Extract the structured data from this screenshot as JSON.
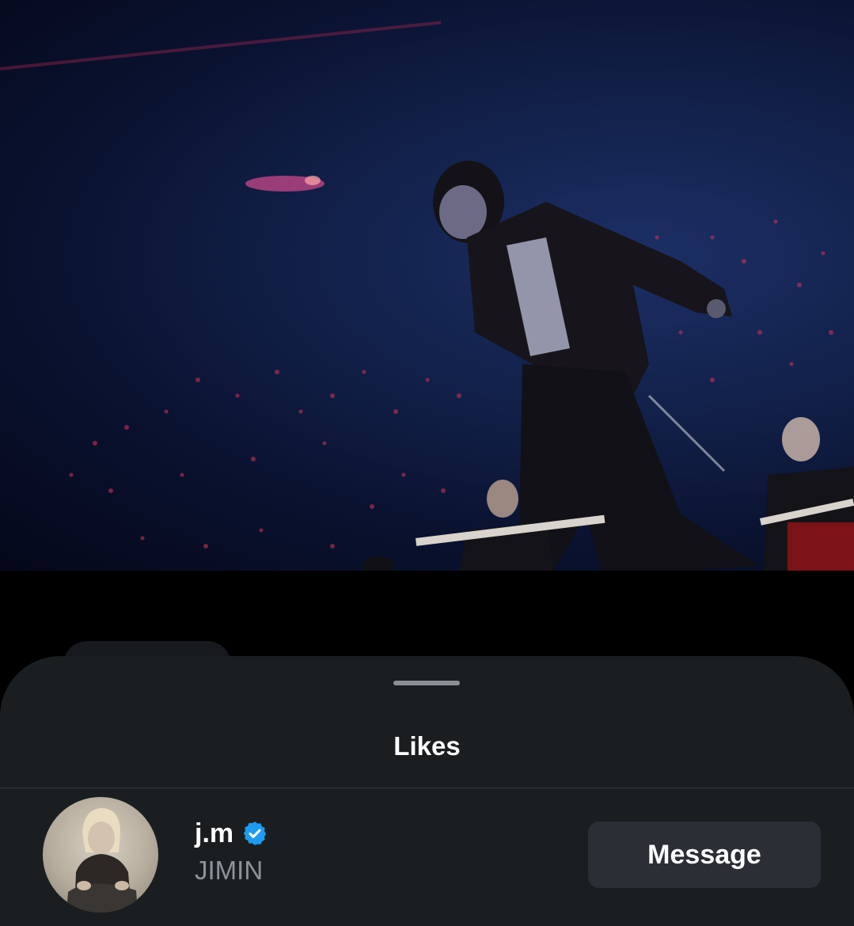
{
  "media": {
    "kind": "video-frame",
    "description_icon": "concert-performance-image"
  },
  "likes_sheet": {
    "title": "Likes",
    "users": [
      {
        "username": "j.m",
        "display_name": "JIMIN",
        "verified": true,
        "avatar_icon": "profile-photo-avatar",
        "action_label": "Message"
      }
    ]
  },
  "colors": {
    "sheet_bg": "#1b1e21",
    "button_bg": "#2b2f35",
    "verified_blue": "#1d9bf0",
    "secondary_text": "#8e939a",
    "media_bg": "#0d1a3f"
  }
}
